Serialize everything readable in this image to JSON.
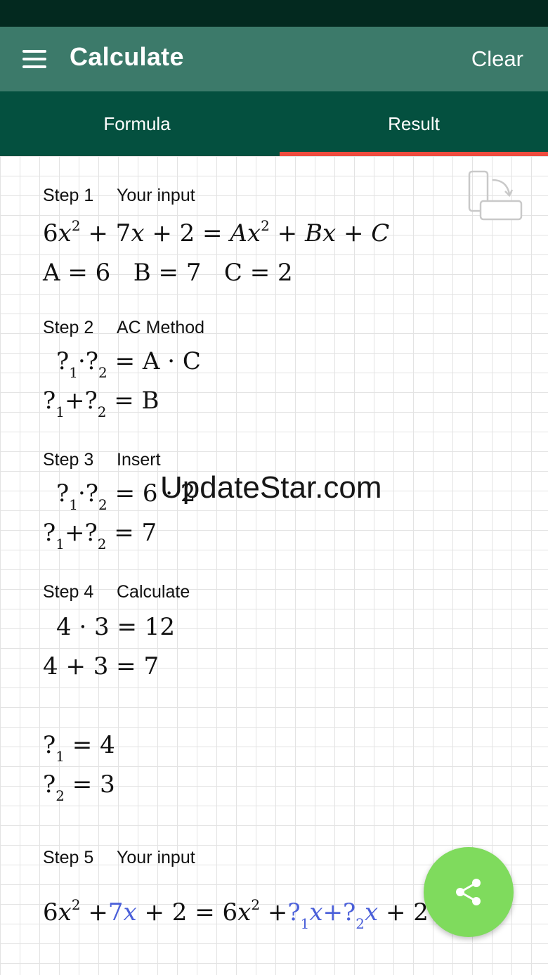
{
  "app": {
    "title": "Calculate",
    "clear_label": "Clear"
  },
  "tabs": [
    {
      "label": "Formula",
      "selected": false
    },
    {
      "label": "Result",
      "selected": true
    }
  ],
  "steps": [
    {
      "number": "Step 1",
      "title": "Your input"
    },
    {
      "number": "Step 2",
      "title": "AC Method"
    },
    {
      "number": "Step 3",
      "title": "Insert"
    },
    {
      "number": "Step 4",
      "title": "Calculate"
    },
    {
      "number": "Step 5",
      "title": "Your input"
    }
  ],
  "math": {
    "s1_eq": {
      "a": "6",
      "x": "x",
      "two": "2",
      "b": "+ 7",
      "c": "+ 2 =",
      "A": "A",
      "B": "+ B",
      "C": "+ C"
    },
    "s1_vals": {
      "A": "A = 6",
      "B": "B = 7",
      "C": "C = 2"
    },
    "s2_product_rhs": "= A · C",
    "s2_sum_rhs": "= B",
    "s3_product_rhs": "= 6 · 2",
    "s3_sum_rhs": "= 7",
    "s4_product": "4 · 3 = 12",
    "s4_sum": "4 + 3 = 7",
    "s4_q1": "= 4",
    "s4_q2": "= 3",
    "placeholder": "?",
    "sub1": "1",
    "sub2": "2",
    "s5_eq": {
      "lead": "6",
      "mid_b": "7",
      "rhs_lead": "+ 2 = 6",
      "tail": "+ 2"
    }
  },
  "watermark": "UpdateStar.com",
  "icons": {
    "menu": "menu-icon",
    "rotate": "rotate-device-icon",
    "share": "share-icon"
  },
  "colors": {
    "status_bar": "#03291f",
    "app_bar": "#3c7a6a",
    "tab_bar": "#04503f",
    "tab_indicator": "#ef4b3e",
    "fab": "#7fdb5d",
    "highlight": "#4a5fd9"
  }
}
